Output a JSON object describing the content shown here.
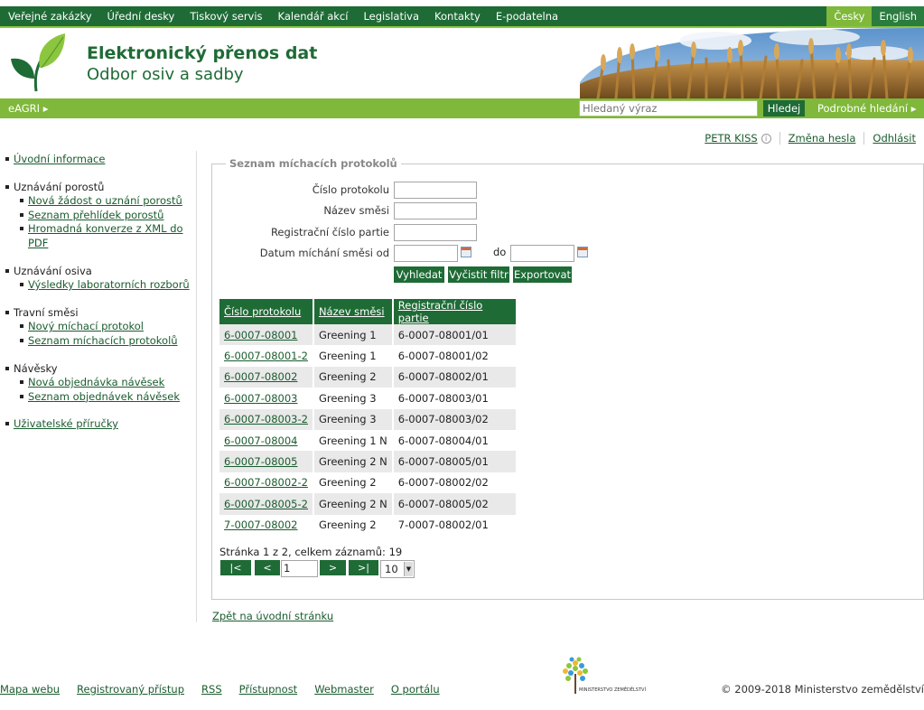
{
  "topnav": {
    "items": [
      "Veřejné zakázky",
      "Úřední desky",
      "Tiskový servis",
      "Kalendář akcí",
      "Legislativa",
      "Kontakty",
      "E-podatelna"
    ],
    "lang_active": "Česky",
    "lang_other": "English"
  },
  "header": {
    "title": "Elektronický přenos dat",
    "subtitle": "Odbor osiv a sadby"
  },
  "greenbar": {
    "eagri": "eAGRI",
    "search_placeholder": "Hledaný výraz",
    "search_button": "Hledej",
    "advanced": "Podrobné hledání"
  },
  "user": {
    "name": "PETR KISS",
    "change_password": "Změna hesla",
    "logout": "Odhlásit"
  },
  "sidebar": {
    "intro": "Úvodní informace",
    "g1": {
      "title": "Uznávání porostů",
      "items": [
        "Nová žádost o uznání porostů",
        "Seznam přehlídek porostů",
        "Hromadná konverze z XML do PDF"
      ]
    },
    "g2": {
      "title": "Uznávání osiva",
      "items": [
        "Výsledky laboratorních rozborů"
      ]
    },
    "g3": {
      "title": "Travní směsi",
      "items": [
        "Nový míchací protokol",
        "Seznam míchacích protokolů"
      ]
    },
    "g4": {
      "title": "Návěsky",
      "items": [
        "Nová objednávka návěsek",
        "Seznam objednávek návěsek"
      ]
    },
    "manuals": "Uživatelské příručky"
  },
  "filter": {
    "legend": "Seznam míchacích protokolů",
    "label_protocol": "Číslo protokolu",
    "label_name": "Název směsi",
    "label_reg": "Registrační číslo partie",
    "label_date_from": "Datum míchání směsi od",
    "label_to": "do",
    "btn_search": "Vyhledat",
    "btn_clear": "Vyčistit filtr",
    "btn_export": "Exportovat"
  },
  "table": {
    "headers": [
      "Číslo protokolu",
      "Název směsi",
      "Registrační číslo partie"
    ],
    "rows": [
      [
        "6-0007-08001",
        "Greening 1",
        "6-0007-08001/01"
      ],
      [
        "6-0007-08001-2",
        "Greening 1",
        "6-0007-08001/02"
      ],
      [
        "6-0007-08002",
        "Greening 2",
        "6-0007-08002/01"
      ],
      [
        "6-0007-08003",
        "Greening 3",
        "6-0007-08003/01"
      ],
      [
        "6-0007-08003-2",
        "Greening 3",
        "6-0007-08003/02"
      ],
      [
        "6-0007-08004",
        "Greening 1 N",
        "6-0007-08004/01"
      ],
      [
        "6-0007-08005",
        "Greening 2 N",
        "6-0007-08005/01"
      ],
      [
        "6-0007-08002-2",
        "Greening 2",
        "6-0007-08002/02"
      ],
      [
        "6-0007-08005-2",
        "Greening 2 N",
        "6-0007-08005/02"
      ],
      [
        "7-0007-08002",
        "Greening 2",
        "7-0007-08002/01"
      ]
    ]
  },
  "pagination": {
    "info": "Stránka 1 z 2, celkem záznamů: 19",
    "first": "|<",
    "prev": "<",
    "page": "1",
    "next": ">",
    "last": ">|",
    "page_size": "10"
  },
  "back_link": "Zpět na úvodní stránku",
  "footer": {
    "links": [
      "Mapa webu",
      "Registrovaný přístup",
      "RSS",
      "Přístupnost",
      "Webmaster",
      "O portálu"
    ],
    "logo_text": "MINISTERSTVO ZEMĚDĚLSTVÍ",
    "copyright": "© 2009-2018 Ministerstvo zemědělství"
  }
}
